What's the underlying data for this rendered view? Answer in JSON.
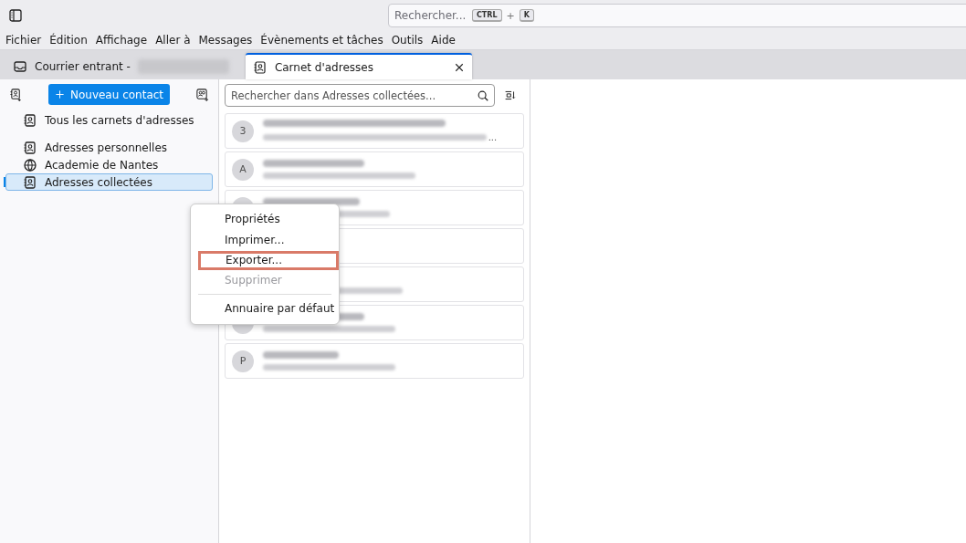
{
  "toolbar": {
    "search": {
      "placeholder": "Rechercher...",
      "keys": [
        "CTRL",
        "+",
        "K"
      ]
    }
  },
  "menubar": [
    "Fichier",
    "Édition",
    "Affichage",
    "Aller à",
    "Messages",
    "Évènements et tâches",
    "Outils",
    "Aide"
  ],
  "tabs": [
    {
      "label": "Courrier entrant -",
      "kind": "inbox",
      "selected": false,
      "redacted": true
    },
    {
      "label": "Carnet d'adresses",
      "kind": "addressbook",
      "selected": true,
      "redacted": false
    }
  ],
  "sidebar": {
    "new_button": "Nouveau contact",
    "groups": [
      {
        "items": [
          {
            "label": "Tous les carnets d'adresses",
            "kind": "book",
            "selected": false
          }
        ]
      },
      {
        "items": [
          {
            "label": "Adresses personnelles",
            "kind": "book",
            "selected": false
          },
          {
            "label": "Academie de Nantes",
            "kind": "globe",
            "selected": false
          },
          {
            "label": "Adresses collectées",
            "kind": "book",
            "selected": true
          }
        ]
      }
    ]
  },
  "list": {
    "search": {
      "placeholder": "Rechercher dans Adresses collectées..."
    },
    "contacts": [
      {
        "kind": "visible",
        "avatar": "3",
        "redacted": true,
        "ellipsis": "..."
      },
      {
        "kind": "visible",
        "avatar": "A",
        "redacted": true
      },
      {
        "kind": "visible",
        "redacted": true
      },
      {
        "kind": "covered",
        "redacted": false
      },
      {
        "kind": "covered",
        "redacted": true
      },
      {
        "kind": "visible",
        "redacted": true
      },
      {
        "kind": "visible",
        "avatar": "P",
        "redacted": true
      }
    ]
  },
  "context_menu": [
    {
      "kind": "item",
      "label": "Propriétés",
      "disabled": false,
      "highlighted": false
    },
    {
      "kind": "item",
      "label": "Imprimer...",
      "disabled": false,
      "highlighted": false
    },
    {
      "kind": "item",
      "label": "Exporter...",
      "disabled": false,
      "highlighted": true
    },
    {
      "kind": "item",
      "label": "Supprimer",
      "disabled": true,
      "highlighted": false
    },
    {
      "kind": "separator"
    },
    {
      "kind": "item",
      "label": "Annuaire par défaut",
      "disabled": false,
      "highlighted": false
    }
  ]
}
